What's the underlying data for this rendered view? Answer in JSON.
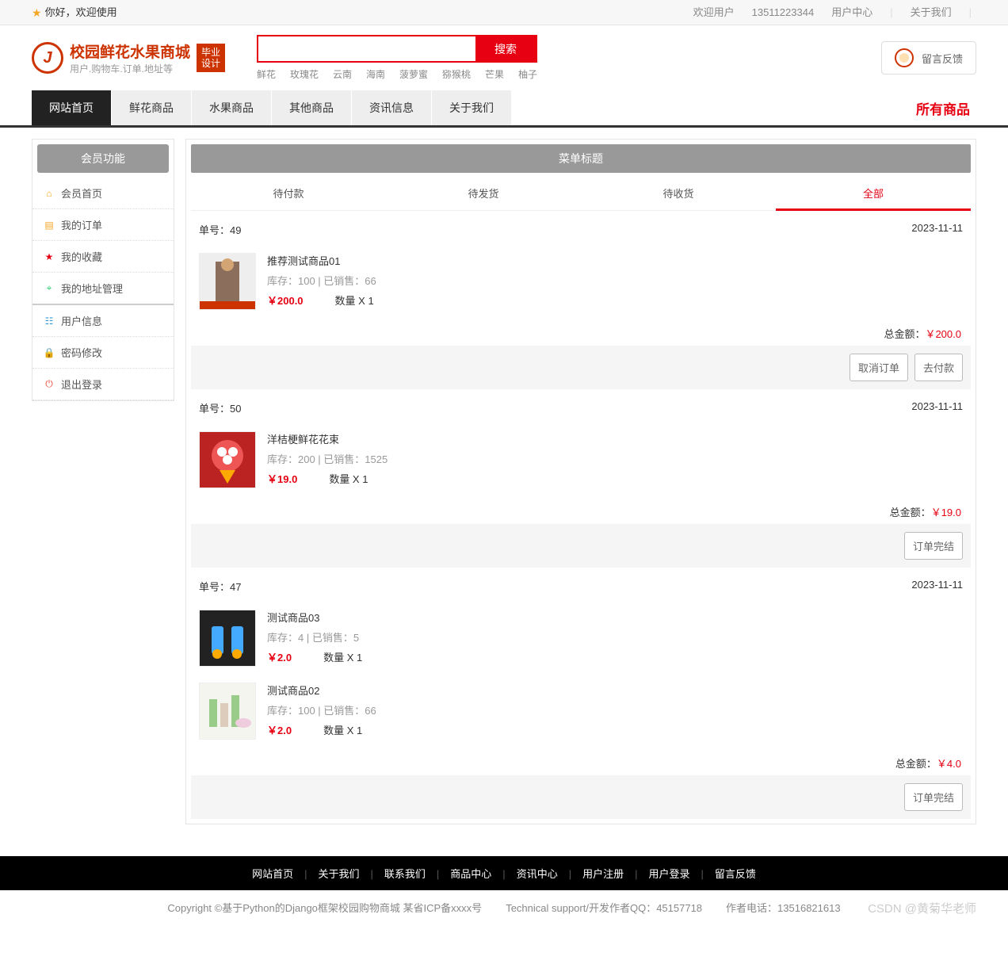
{
  "topbar": {
    "greeting": "你好，欢迎使用",
    "welcome_user": "欢迎用户",
    "phone": "13511223344",
    "user_center": "用户中心",
    "about": "关于我们"
  },
  "logo": {
    "title": "校园鲜花水果商城",
    "sub": "用户.购物车.订单.地址等",
    "badge1": "毕业",
    "badge2": "设计"
  },
  "search": {
    "button": "搜索",
    "hot": [
      "鲜花",
      "玫瑰花",
      "云南",
      "海南",
      "菠萝蜜",
      "猕猴桃",
      "芒果",
      "柚子"
    ]
  },
  "feedback_label": "留言反馈",
  "nav": {
    "items": [
      "网站首页",
      "鲜花商品",
      "水果商品",
      "其他商品",
      "资讯信息",
      "关于我们"
    ],
    "all": "所有商品"
  },
  "sidebar": {
    "title": "会员功能",
    "items": [
      {
        "icon": "home",
        "color": "#f5a623",
        "label": "会员首页"
      },
      {
        "icon": "order",
        "color": "#f5a623",
        "label": "我的订单"
      },
      {
        "icon": "star",
        "color": "#e60012",
        "label": "我的收藏"
      },
      {
        "icon": "pin",
        "color": "#2ecc71",
        "label": "我的地址管理"
      },
      {
        "icon": "user",
        "color": "#3498db",
        "label": "用户信息"
      },
      {
        "icon": "lock",
        "color": "#e67e22",
        "label": "密码修改"
      },
      {
        "icon": "power",
        "color": "#e74c3c",
        "label": "退出登录"
      }
    ]
  },
  "main_title": "菜单标题",
  "tabs": [
    "待付款",
    "待发货",
    "待收货",
    "全部"
  ],
  "orders": [
    {
      "no_label": "单号：",
      "no": "49",
      "date": "2023-11-11",
      "products": [
        {
          "name": "推荐测试商品01",
          "stock_label": "库存：",
          "stock": "100",
          "sold_label": "已销售：",
          "sold": "66",
          "price": "￥200.0",
          "qty_label": "数量 X",
          "qty": "1",
          "img": "coat"
        }
      ],
      "total_label": "总金额：",
      "total": "￥200.0",
      "actions": [
        "取消订单",
        "去付款"
      ]
    },
    {
      "no_label": "单号：",
      "no": "50",
      "date": "2023-11-11",
      "products": [
        {
          "name": "洋桔梗鲜花花束",
          "stock_label": "库存：",
          "stock": "200",
          "sold_label": "已销售：",
          "sold": "1525",
          "price": "￥19.0",
          "qty_label": "数量 X",
          "qty": "1",
          "img": "flower"
        }
      ],
      "total_label": "总金额：",
      "total": "￥19.0",
      "actions": [
        "订单完结"
      ]
    },
    {
      "no_label": "单号：",
      "no": "47",
      "date": "2023-11-11",
      "products": [
        {
          "name": "测试商品03",
          "stock_label": "库存：",
          "stock": "4",
          "sold_label": "已销售：",
          "sold": "5",
          "price": "￥2.0",
          "qty_label": "数量 X",
          "qty": "1",
          "img": "bottles"
        },
        {
          "name": "测试商品02",
          "stock_label": "库存：",
          "stock": "100",
          "sold_label": "已销售：",
          "sold": "66",
          "price": "￥2.0",
          "qty_label": "数量 X",
          "qty": "1",
          "img": "cosmetics"
        }
      ],
      "total_label": "总金额：",
      "total": "￥4.0",
      "actions": [
        "订单完结"
      ]
    }
  ],
  "footer": {
    "nav": [
      "网站首页",
      "关于我们",
      "联系我们",
      "商品中心",
      "资讯中心",
      "用户注册",
      "用户登录",
      "留言反馈"
    ],
    "copyright": "Copyright ©基于Python的Django框架校园购物商城 某省ICP备xxxx号",
    "tech": "Technical support/开发作者QQ：45157718",
    "author": "作者电话：13516821613",
    "watermark": "CSDN @黄菊华老师"
  }
}
